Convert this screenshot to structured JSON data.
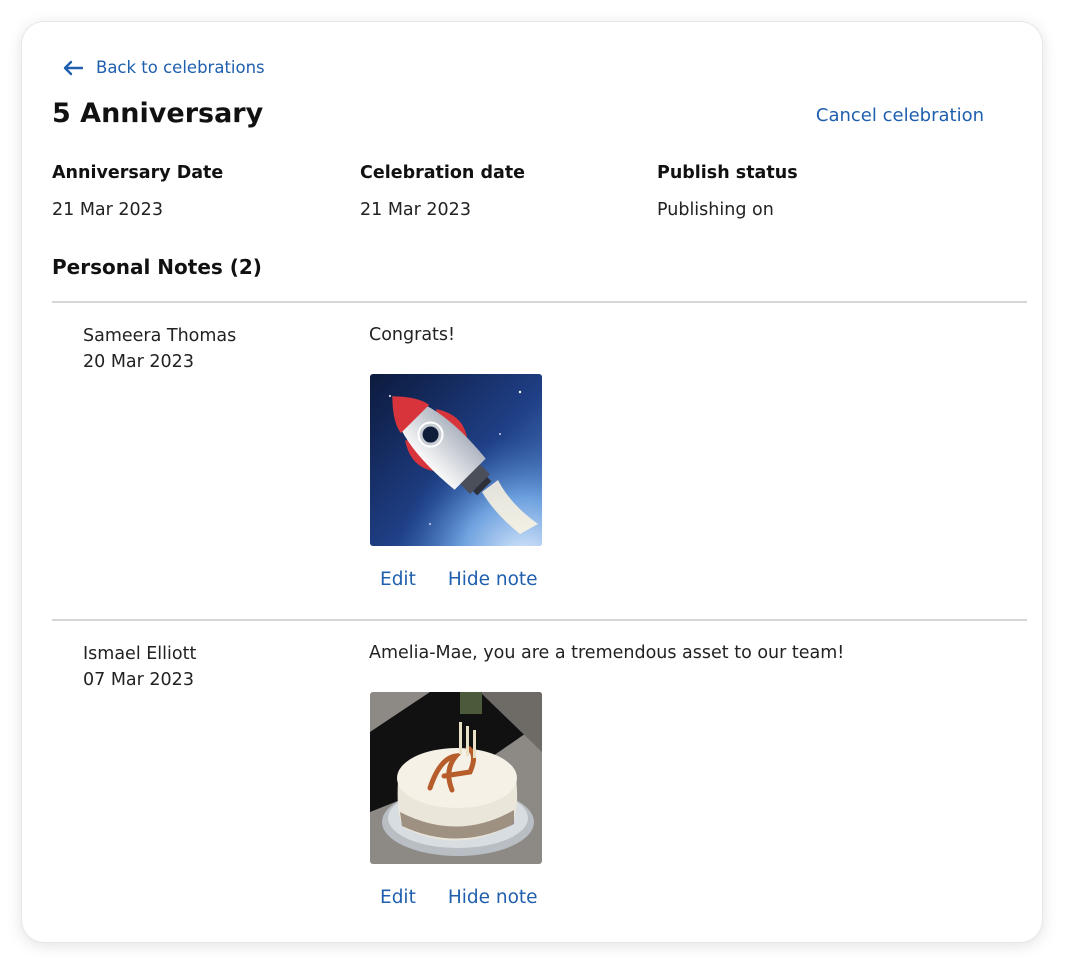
{
  "nav": {
    "back_label": "Back to celebrations",
    "back_icon": "arrow-left-icon"
  },
  "header": {
    "title": "5 Anniversary",
    "cancel_label": "Cancel celebration"
  },
  "details": [
    {
      "label": "Anniversary Date",
      "value": "21 Mar 2023"
    },
    {
      "label": "Celebration date",
      "value": "21 Mar 2023"
    },
    {
      "label": "Publish status",
      "value": "Publishing on"
    }
  ],
  "notes_section": {
    "title": "Personal Notes (2)"
  },
  "notes": [
    {
      "author": "Sameera Thomas",
      "date": "20 Mar 2023",
      "message": "Congrats!",
      "image": "rocket-image",
      "edit_label": "Edit",
      "hide_label": "Hide note"
    },
    {
      "author": "Ismael Elliott",
      "date": "07 Mar 2023",
      "message": "Amelia-Mae, you are a tremendous asset to our team!",
      "image": "birthday-cake-image",
      "edit_label": "Edit",
      "hide_label": "Hide note"
    }
  ],
  "colors": {
    "link": "#1f5fae",
    "divider": "#d6d6d6",
    "text": "#1c1c1c"
  }
}
